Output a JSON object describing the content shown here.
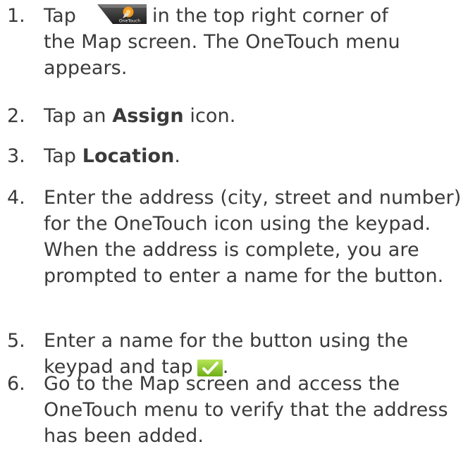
{
  "steps": [
    {
      "number": "1.",
      "line1_prefix": "Tap",
      "onetouch_icon_label": "OneTouch",
      "line1_suffix": "in the top right corner of",
      "rest": "the Map screen. The OneTouch menu appears."
    },
    {
      "number": "2.",
      "prefix": "Tap an ",
      "bold": "Assign",
      "suffix": " icon."
    },
    {
      "number": "3.",
      "prefix": "Tap ",
      "bold": "Location",
      "suffix": "."
    },
    {
      "number": "4.",
      "text": "Enter the address (city, street and number) for the OneTouch icon using the keypad. When the address is complete, you are prompted to enter a name for the button."
    },
    {
      "number": "5.",
      "prefix": "Enter a name for the button using the keypad and tap",
      "suffix": "."
    },
    {
      "number": "6.",
      "text": "Go to the Map screen and access the OneTouch menu to verify that the address has been added."
    }
  ],
  "icons": {
    "onetouch": "onetouch-icon",
    "confirm": "checkmark-icon"
  },
  "colors": {
    "text": "#3a3a3a",
    "check_bg": "#8fce2a",
    "icon_dark": "#3c3c3c",
    "icon_orange": "#f29a1e"
  }
}
